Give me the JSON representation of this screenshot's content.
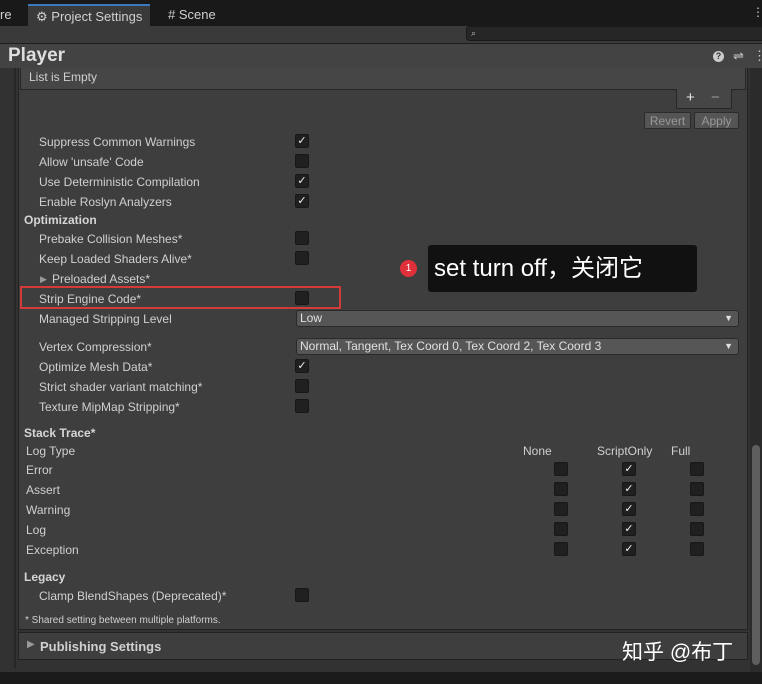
{
  "tabs": [
    {
      "label": "re"
    },
    {
      "label": "Project Settings",
      "icon": "gear-icon"
    },
    {
      "label": "Scene",
      "icon": "hash-icon"
    }
  ],
  "header": {
    "title": "Player"
  },
  "list": {
    "empty_text": "List is Empty",
    "add": "+",
    "remove": "−"
  },
  "buttons": {
    "revert": "Revert",
    "apply": "Apply"
  },
  "rows": [
    {
      "label": "Suppress Common Warnings",
      "type": "check",
      "checked": true
    },
    {
      "label": "Allow 'unsafe' Code",
      "type": "check",
      "checked": false
    },
    {
      "label": "Use Deterministic Compilation",
      "type": "check",
      "checked": true
    },
    {
      "label": "Enable Roslyn Analyzers",
      "type": "check",
      "checked": true
    },
    {
      "label": "Optimization",
      "type": "header"
    },
    {
      "label": "Prebake Collision Meshes*",
      "type": "check",
      "checked": false
    },
    {
      "label": "Keep Loaded Shaders Alive*",
      "type": "check",
      "checked": false
    },
    {
      "label": "Preloaded Assets*",
      "type": "foldout"
    },
    {
      "label": "Strip Engine Code*",
      "type": "check",
      "checked": false
    },
    {
      "label": "Managed Stripping Level",
      "type": "dropdown",
      "value": "Low"
    },
    {
      "label": "Vertex Compression*",
      "type": "dropdown",
      "value": "Normal, Tangent, Tex Coord 0, Tex Coord 2, Tex Coord 3"
    },
    {
      "label": "Optimize Mesh Data*",
      "type": "check",
      "checked": true
    },
    {
      "label": "Strict shader variant matching*",
      "type": "check",
      "checked": false
    },
    {
      "label": "Texture MipMap Stripping*",
      "type": "check",
      "checked": false
    },
    {
      "label": "Stack Trace*",
      "type": "header"
    }
  ],
  "stack_trace": {
    "col_label": "Log Type",
    "columns": [
      "None",
      "ScriptOnly",
      "Full"
    ],
    "rows": [
      {
        "label": "Error",
        "selected": 1
      },
      {
        "label": "Assert",
        "selected": 1
      },
      {
        "label": "Warning",
        "selected": 1
      },
      {
        "label": "Log",
        "selected": 1
      },
      {
        "label": "Exception",
        "selected": 1
      }
    ]
  },
  "legacy": {
    "header": "Legacy",
    "label": "Clamp BlendShapes (Deprecated)*",
    "checked": false
  },
  "footnote": "* Shared setting between multiple platforms.",
  "publishing": "Publishing Settings",
  "annotation": {
    "badge": "1",
    "text": "set turn off，关闭它",
    "color": "#e0303a"
  },
  "watermark": "知乎 @布丁"
}
